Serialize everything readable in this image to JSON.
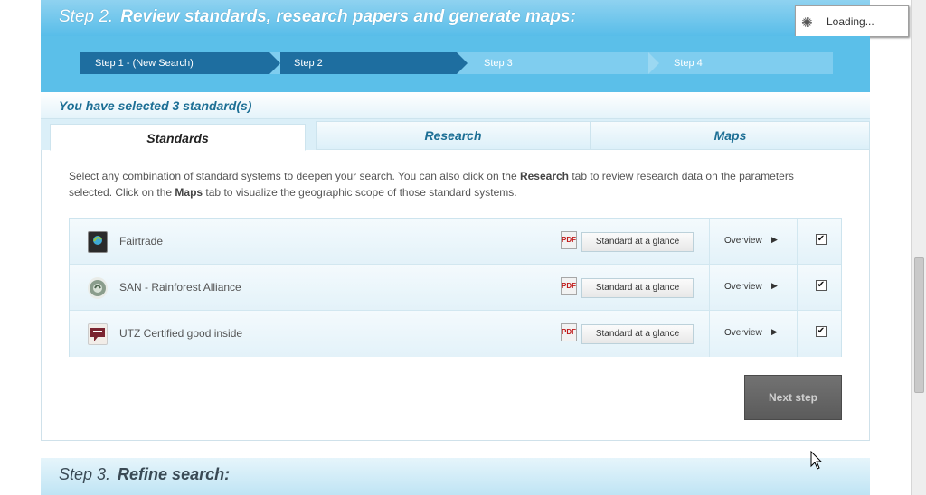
{
  "header": {
    "step_number": "Step 2.",
    "title": "Review standards, research papers and generate maps:"
  },
  "loading": {
    "label": "Loading..."
  },
  "steps": [
    {
      "label": "Step 1 - (New Search)"
    },
    {
      "label": "Step 2"
    },
    {
      "label": "Step 3"
    },
    {
      "label": "Step 4"
    }
  ],
  "selection": {
    "text": "You have selected 3 standard(s)"
  },
  "tabs": [
    {
      "label": "Standards"
    },
    {
      "label": "Research"
    },
    {
      "label": "Maps"
    }
  ],
  "description": {
    "part1": "Select any combination of standard systems to deepen your search. You can also click on the ",
    "research": "Research",
    "part2": " tab to review research data on the parameters selected. Click on the ",
    "maps": "Maps",
    "part3": " tab to visualize the geographic scope of those standard systems."
  },
  "standards": [
    {
      "name": "Fairtrade",
      "glance_label": "Standard at a glance",
      "overview_label": "Overview",
      "checked": true
    },
    {
      "name": "SAN - Rainforest Alliance",
      "glance_label": "Standard at a glance",
      "overview_label": "Overview",
      "checked": true
    },
    {
      "name": "UTZ Certified good inside",
      "glance_label": "Standard at a glance",
      "overview_label": "Overview",
      "checked": true
    }
  ],
  "next_button": {
    "label": "Next step"
  },
  "step3": {
    "step_number": "Step 3.",
    "title": "Refine search:"
  },
  "colors": {
    "header_blue": "#58bde9",
    "active_step": "#1e6ea0",
    "link_blue": "#1d6f95"
  },
  "icons": {
    "pdf": "pdf-icon",
    "chevron": "chevron-right-icon",
    "spinner": "spinner-icon"
  }
}
